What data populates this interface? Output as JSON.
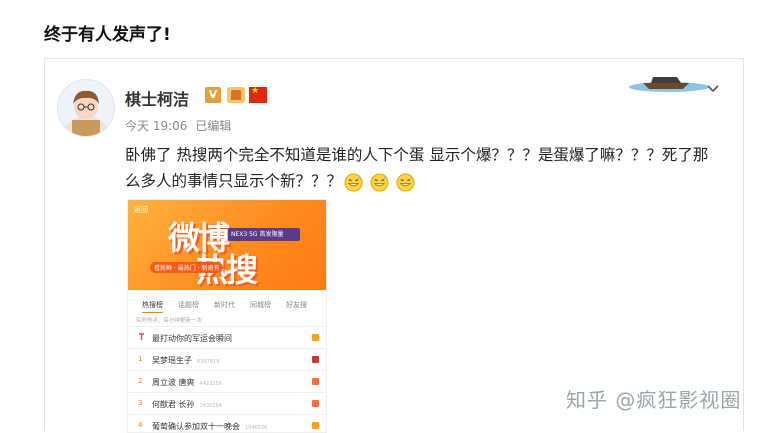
{
  "heading": "终于有人发声了!",
  "post": {
    "username": "棋士柯洁",
    "verified_badge": "V",
    "time": "今天 19:06",
    "edited": "已编辑",
    "text": "卧佛了 热搜两个完全不知道是谁的人下个蛋 显示个爆？？？是蛋爆了嘛？？？死了那么多人的事情只显示个新？？？",
    "emoji_icon": "grin-sweat-emoji",
    "emoji_count": 3
  },
  "embed": {
    "back": "返回",
    "title_line1": "微博",
    "title_line2": "热搜",
    "phone_ad": "NEX3 5G 首发限量",
    "subtitle": "看新鲜 · 最热门 · 新奇有",
    "tabs": [
      "热搜榜",
      "话题榜",
      "新时代",
      "同城榜",
      "好友搜"
    ],
    "update_note": "实时热点，每分钟更新一次",
    "rows": [
      {
        "rank": "",
        "title": "最打动你的军运会瞬间",
        "count": "",
        "tag": "hot"
      },
      {
        "rank": "1",
        "title": "吴梦瑶生子",
        "count": "6307919",
        "tag": "bao"
      },
      {
        "rank": "2",
        "title": "周立波 唐爽",
        "count": "4423256",
        "tag": "re"
      },
      {
        "rank": "3",
        "title": "何猷君 长孙",
        "count": "2430184",
        "tag": "re"
      },
      {
        "rank": "4",
        "title": "葡萄确认参加双十一晚会",
        "count": "1946536",
        "tag": "new"
      }
    ],
    "tag_colors": {
      "hot": "#ff9f1a",
      "bao": "#d1372a",
      "re": "#ff6a3a",
      "new": "#ff9f1a"
    }
  },
  "watermark": "知乎 @疯狂影视圈",
  "icons": {
    "more": "chevron-down-icon",
    "decoration": "boat-icon"
  }
}
